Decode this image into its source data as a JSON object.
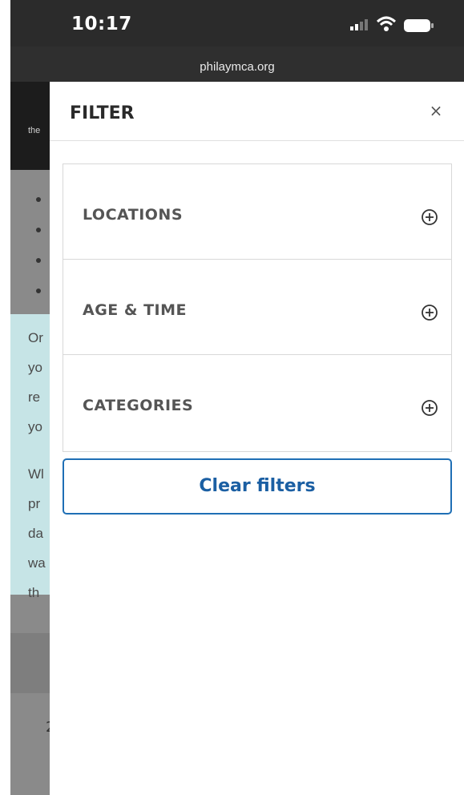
{
  "status_bar": {
    "time": "10:17",
    "icons": [
      "signal-icon",
      "wifi-icon",
      "battery-icon"
    ]
  },
  "url_bar": {
    "domain": "philaymca.org"
  },
  "background_page": {
    "header_fragment": "the",
    "text_fragments": [
      "Or",
      "yo",
      "re",
      "yo",
      "Wl",
      "pr",
      "da",
      "wa",
      "th"
    ],
    "number_fragment": "2",
    "colors": {
      "header": "#1c1c1c",
      "panel": "#c6e4e6"
    }
  },
  "drawer": {
    "title": "FILTER",
    "close_label": "×",
    "sections": [
      {
        "label": "LOCATIONS",
        "icon": "plus-circle-icon"
      },
      {
        "label": "AGE & TIME",
        "icon": "plus-circle-icon"
      },
      {
        "label": "CATEGORIES",
        "icon": "plus-circle-icon"
      }
    ],
    "clear_button": "Clear filters",
    "accent_color": "#1b5fa3"
  }
}
